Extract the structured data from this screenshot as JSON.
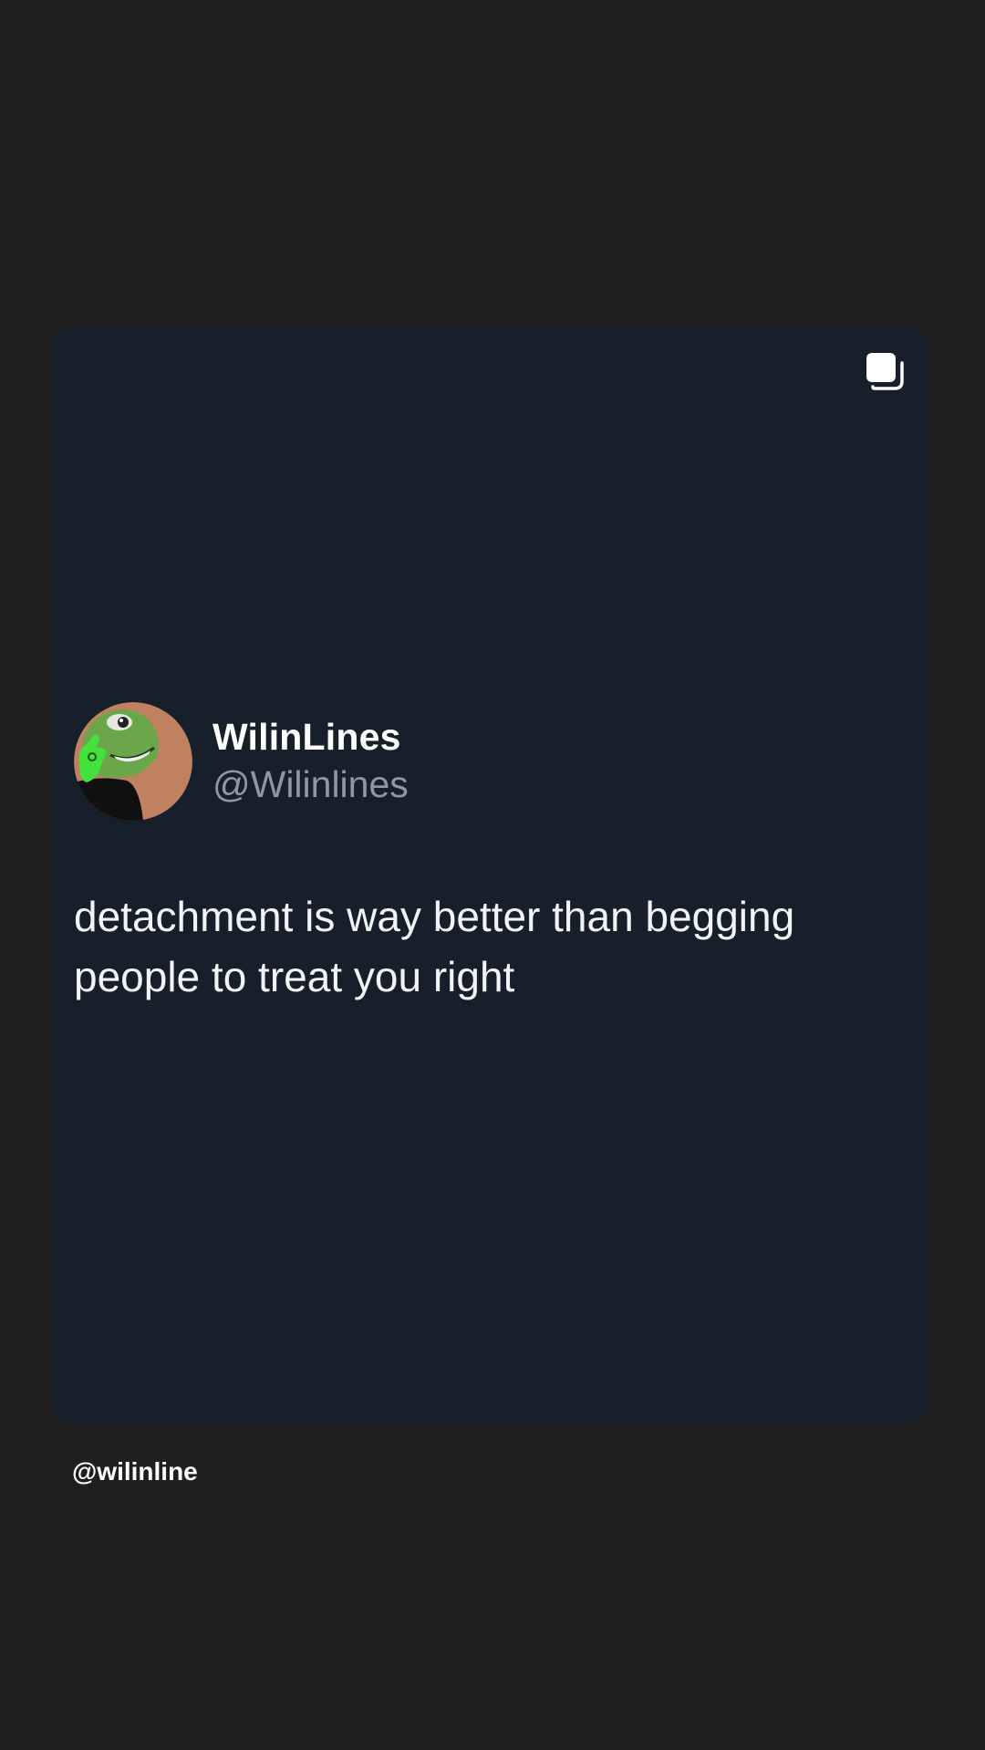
{
  "post": {
    "multi_image_icon": "stacked-squares-icon",
    "author": {
      "display_name": "WilinLines",
      "handle": "@Wilinlines",
      "avatar_icon": "frog-avatar"
    },
    "text": "detachment is way better than begging people to treat you right"
  },
  "footer": {
    "account_tag": "@wilinline"
  },
  "colors": {
    "background": "#1f1f1f",
    "card": "#17202a",
    "handle": "#8b98a5",
    "text": "#f1f3f5"
  }
}
